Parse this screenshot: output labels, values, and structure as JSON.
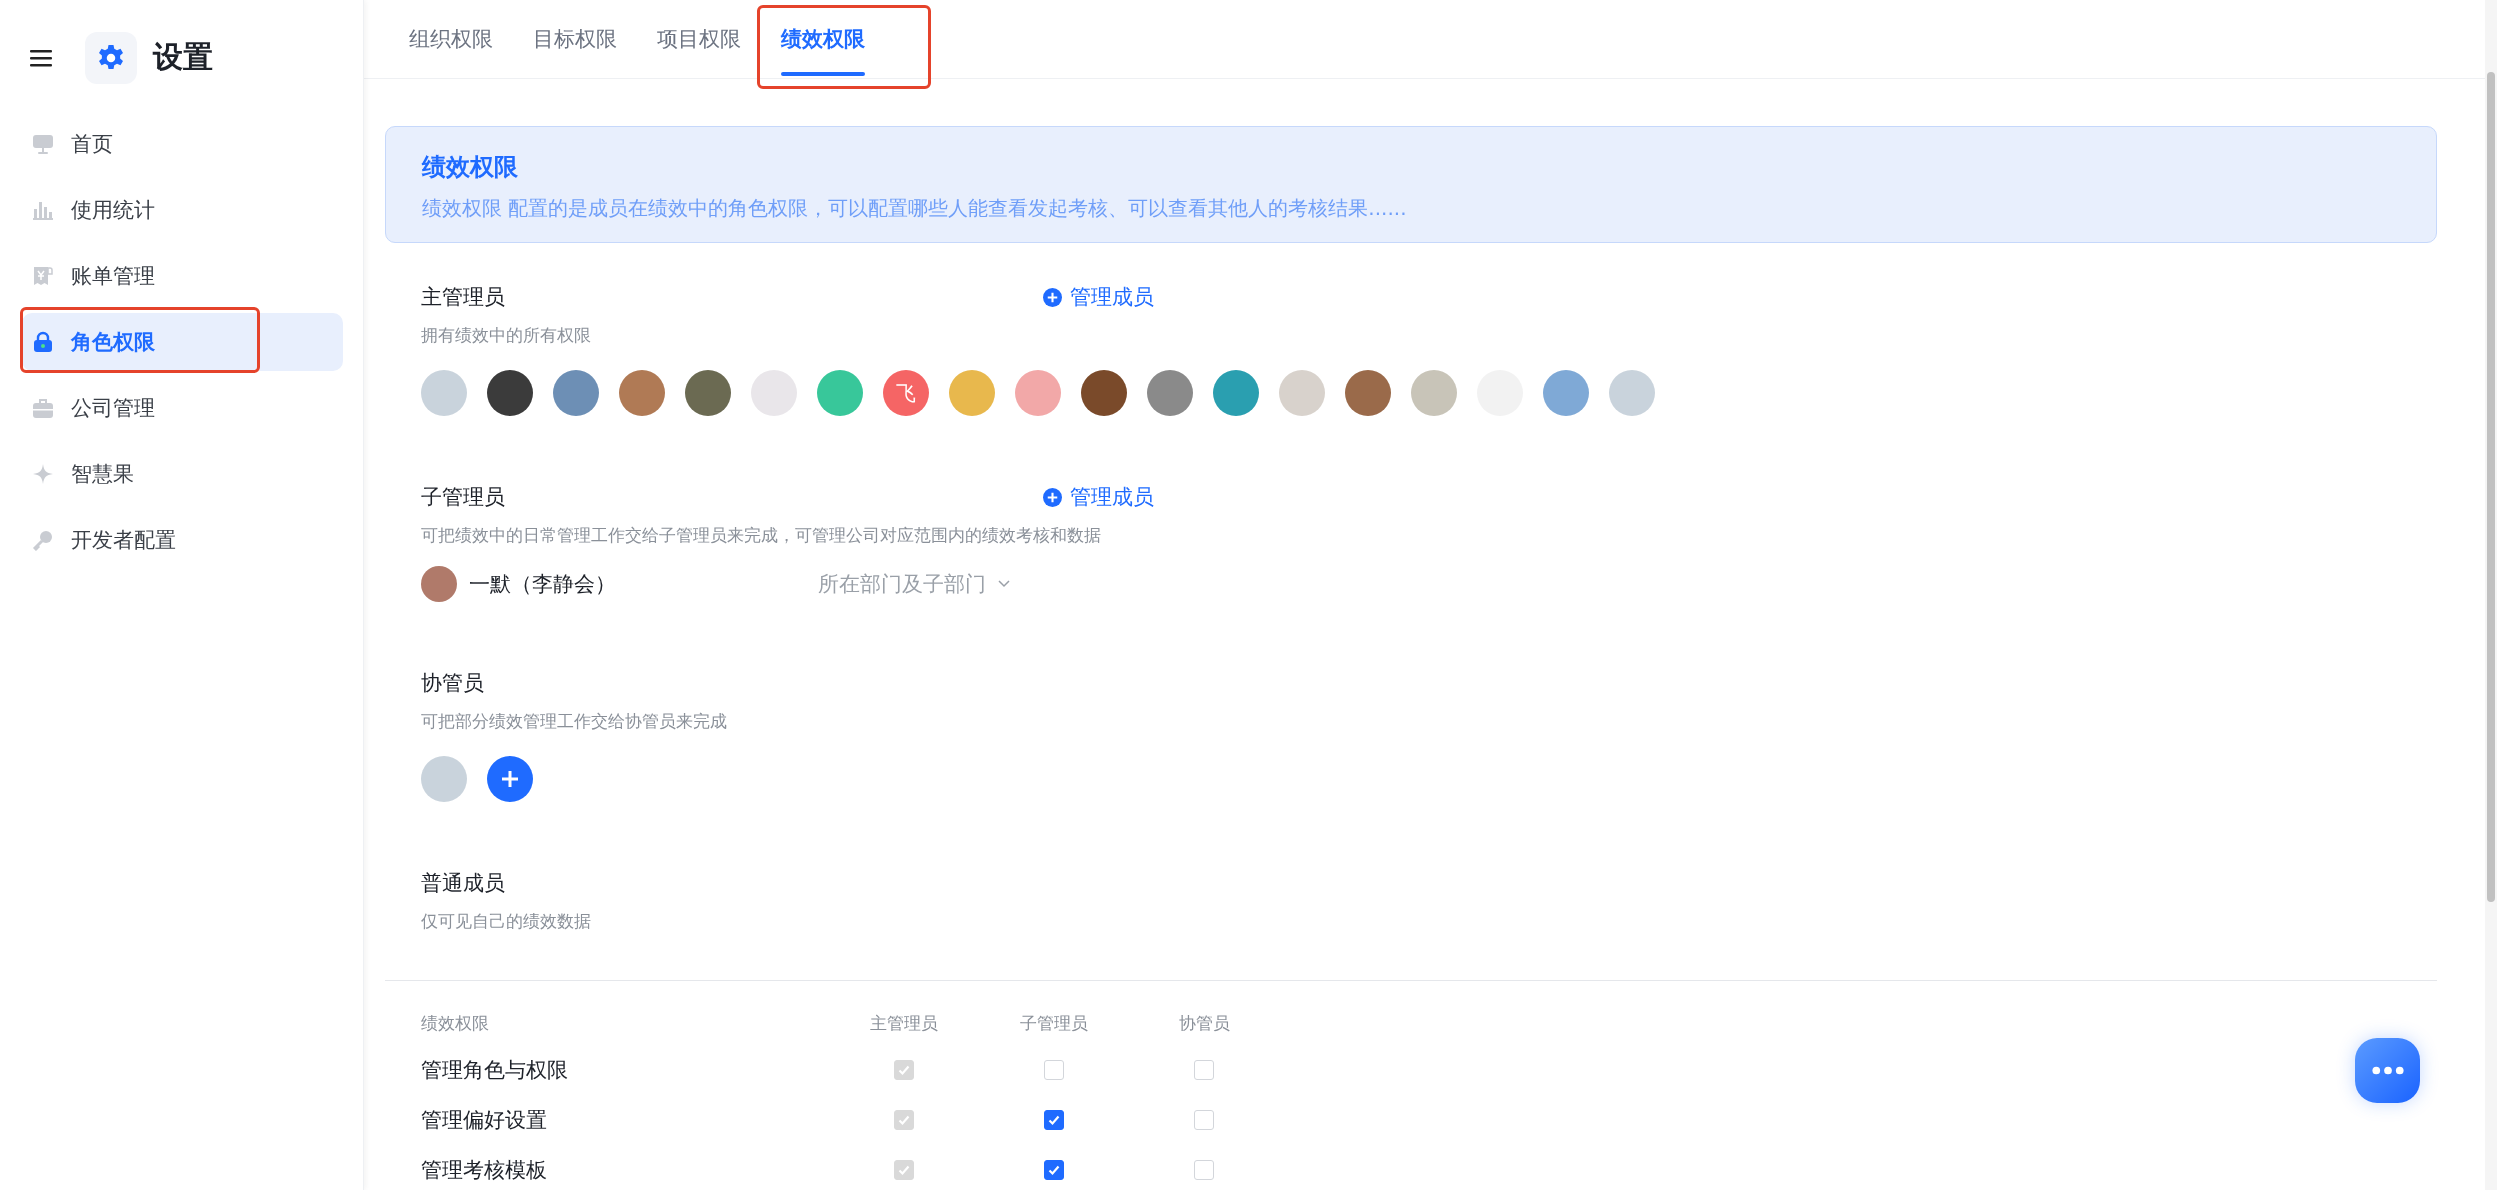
{
  "sidebar": {
    "title": "设置",
    "items": [
      {
        "label": "首页",
        "selected": false,
        "highlighted": false
      },
      {
        "label": "使用统计",
        "selected": false,
        "highlighted": false
      },
      {
        "label": "账单管理",
        "selected": false,
        "highlighted": false
      },
      {
        "label": "角色权限",
        "selected": true,
        "highlighted": true
      },
      {
        "label": "公司管理",
        "selected": false,
        "highlighted": false
      },
      {
        "label": "智慧果",
        "selected": false,
        "highlighted": false
      },
      {
        "label": "开发者配置",
        "selected": false,
        "highlighted": false
      }
    ]
  },
  "tabs": [
    {
      "label": "组织权限",
      "selected": false,
      "highlighted": false
    },
    {
      "label": "目标权限",
      "selected": false,
      "highlighted": false
    },
    {
      "label": "项目权限",
      "selected": false,
      "highlighted": false
    },
    {
      "label": "绩效权限",
      "selected": true,
      "highlighted": true
    }
  ],
  "banner": {
    "title": "绩效权限",
    "description": "绩效权限 配置的是成员在绩效中的角色权限，可以配置哪些人能查看发起考核、可以查看其他人的考核结果......"
  },
  "roles": [
    {
      "title": "主管理员",
      "action": "管理成员",
      "description": "拥有绩效中的所有权限",
      "members": [
        {
          "kind": "photo"
        },
        {
          "kind": "photo"
        },
        {
          "kind": "photo"
        },
        {
          "kind": "photo"
        },
        {
          "kind": "photo"
        },
        {
          "kind": "photo"
        },
        {
          "kind": "photo"
        },
        {
          "kind": "initial",
          "text": "飞"
        },
        {
          "kind": "photo"
        },
        {
          "kind": "photo"
        },
        {
          "kind": "photo"
        },
        {
          "kind": "photo"
        },
        {
          "kind": "photo"
        },
        {
          "kind": "photo"
        },
        {
          "kind": "photo"
        },
        {
          "kind": "photo"
        },
        {
          "kind": "photo"
        },
        {
          "kind": "photo"
        },
        {
          "kind": "photo"
        }
      ]
    },
    {
      "title": "子管理员",
      "action": "管理成员",
      "description": "可把绩效中的日常管理工作交给子管理员来完成，可管理公司对应范围内的绩效考核和数据",
      "members": [
        {
          "kind": "person",
          "name": "一默（李静会）",
          "scope": "所在部门及子部门"
        }
      ]
    },
    {
      "title": "协管员",
      "description": "可把部分绩效管理工作交给协管员来完成",
      "can_add": true,
      "members": [
        {
          "kind": "photo"
        }
      ]
    },
    {
      "title": "普通成员",
      "description": "仅可见自己的绩效数据"
    }
  ],
  "permissions": {
    "columns": [
      "绩效权限",
      "主管理员",
      "子管理员",
      "协管员"
    ],
    "rows": [
      {
        "label": "管理角色与权限",
        "cells": [
          {
            "checked": true,
            "disabled": true
          },
          {
            "checked": false,
            "disabled": false
          },
          {
            "checked": false,
            "disabled": false
          }
        ]
      },
      {
        "label": "管理偏好设置",
        "cells": [
          {
            "checked": true,
            "disabled": true
          },
          {
            "checked": true,
            "disabled": false
          },
          {
            "checked": false,
            "disabled": false
          }
        ]
      },
      {
        "label": "管理考核模板",
        "cells": [
          {
            "checked": true,
            "disabled": true
          },
          {
            "checked": true,
            "disabled": false
          },
          {
            "checked": false,
            "disabled": false
          }
        ]
      }
    ]
  }
}
